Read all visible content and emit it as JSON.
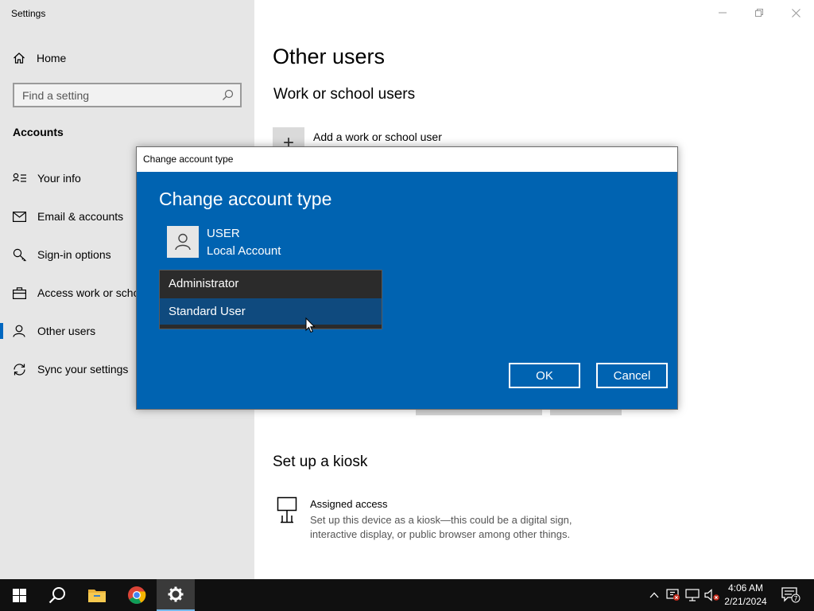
{
  "window": {
    "title": "Settings",
    "minimize_icon": "minimize-icon",
    "restore_icon": "restore-icon",
    "close_icon": "close-icon"
  },
  "nav": {
    "home_label": "Home",
    "search_placeholder": "Find a setting",
    "section_label": "Accounts",
    "items": [
      {
        "label": "Your info",
        "icon": "person-card-icon"
      },
      {
        "label": "Email & accounts",
        "icon": "mail-icon"
      },
      {
        "label": "Sign-in options",
        "icon": "key-icon"
      },
      {
        "label": "Access work or scho",
        "icon": "briefcase-icon"
      },
      {
        "label": "Other users",
        "icon": "person-icon",
        "active": true
      },
      {
        "label": "Sync your settings",
        "icon": "sync-icon"
      }
    ]
  },
  "main": {
    "title": "Other users",
    "work_section_title": "Work or school users",
    "add_work_label": "Add a work or school user",
    "kiosk_section_title": "Set up a kiosk",
    "kiosk_item_title": "Assigned access",
    "kiosk_item_desc": "Set up this device as a kiosk—this could be a digital sign, interactive display, or public browser among other things."
  },
  "dialog": {
    "window_title": "Change account type",
    "heading": "Change account type",
    "user_name": "USER",
    "user_type": "Local Account",
    "options": [
      "Administrator",
      "Standard User"
    ],
    "hovered_option": "Standard User",
    "ok_label": "OK",
    "cancel_label": "Cancel"
  },
  "taskbar": {
    "time": "4:06 AM",
    "date": "2/21/2024",
    "notification_count": "7"
  },
  "colors": {
    "dialog_bg": "#0063b1",
    "accent": "#0067c0",
    "nav_bg": "#e6e6e6",
    "taskbar_bg": "#101010"
  }
}
